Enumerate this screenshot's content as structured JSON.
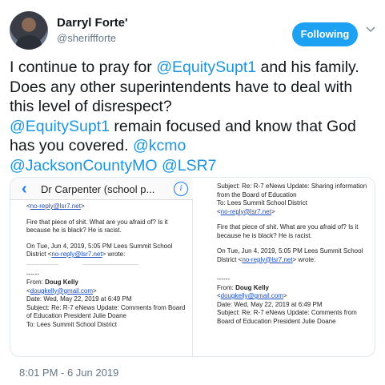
{
  "header": {
    "display_name": "Darryl Forte'",
    "handle": "@sheriffforte",
    "follow_label": "Following",
    "avatar_icon": "profile-photo",
    "caret_icon": "chevron-down-icon",
    "accent_color": "#1da1f2",
    "link_color": "#1b95e0"
  },
  "tweet": {
    "t1": "I continue to pray for ",
    "m1": "@EquitySupt1",
    "t2": " and his family.  Does any other superintendents have to deal with this level of disrespect?",
    "m2": "@EquitySupt1",
    "t3": " remain focused and know that God has you covered. ",
    "m3": "@kcmo",
    "m4": "@JacksonCountyMO",
    "t4": " ",
    "m5": "@LSR7"
  },
  "media": {
    "left": {
      "back_icon": "chevron-left-icon",
      "bar_title": "Dr Carpenter (school p...",
      "info_icon": "info-icon",
      "line_noreply": "no-reply@lsr7.net",
      "body1": "Fire that piece of shit.  What are you afraid of?  Is it because he is black?  He is racist.",
      "quote_header_a": "On Tue, Jun 4, 2019, 5:05 PM Lees Summit School District <",
      "quote_header_link": "no-reply@lsr7.net",
      "quote_header_b": "> wrote:",
      "sep": "------",
      "from_label": "From: ",
      "from_name": "Doug Kelly",
      "from_email": "dougkelly@gmail.com",
      "date": "Date: Wed, May 22, 2019 at 6:49 PM",
      "subject": "Subject: Re: R-7 eNews Update: Comments from Board of Education President Julie Doane",
      "to": "To: Lees Summit School District"
    },
    "right": {
      "subject_top": "Subject: Re: R-7 eNews Update: Sharing information from the Board of Education",
      "to_top": "To: Lees Summit School District",
      "line_noreply": "no-reply@lsr7.net",
      "body1": "Fire that piece of shit.  What are you afraid of?  Is it because he is black?  He is racist.",
      "quote_header_a": "On Tue, Jun 4, 2019, 5:05 PM Lees Summit School District <",
      "quote_header_link": "no-reply@lsr7.net",
      "quote_header_b": "> wrote:",
      "sep": "------",
      "from_label": "From: ",
      "from_name": "Doug Kelly",
      "from_email": "dougkelly@gmail.com",
      "date": "Date: Wed, May 22, 2019 at 6:49 PM",
      "subject": "Subject: Re: R-7 eNews Update: Comments from Board of Education President Julie Doane"
    }
  },
  "timestamp": "8:01 PM - 6 Jun 2019"
}
